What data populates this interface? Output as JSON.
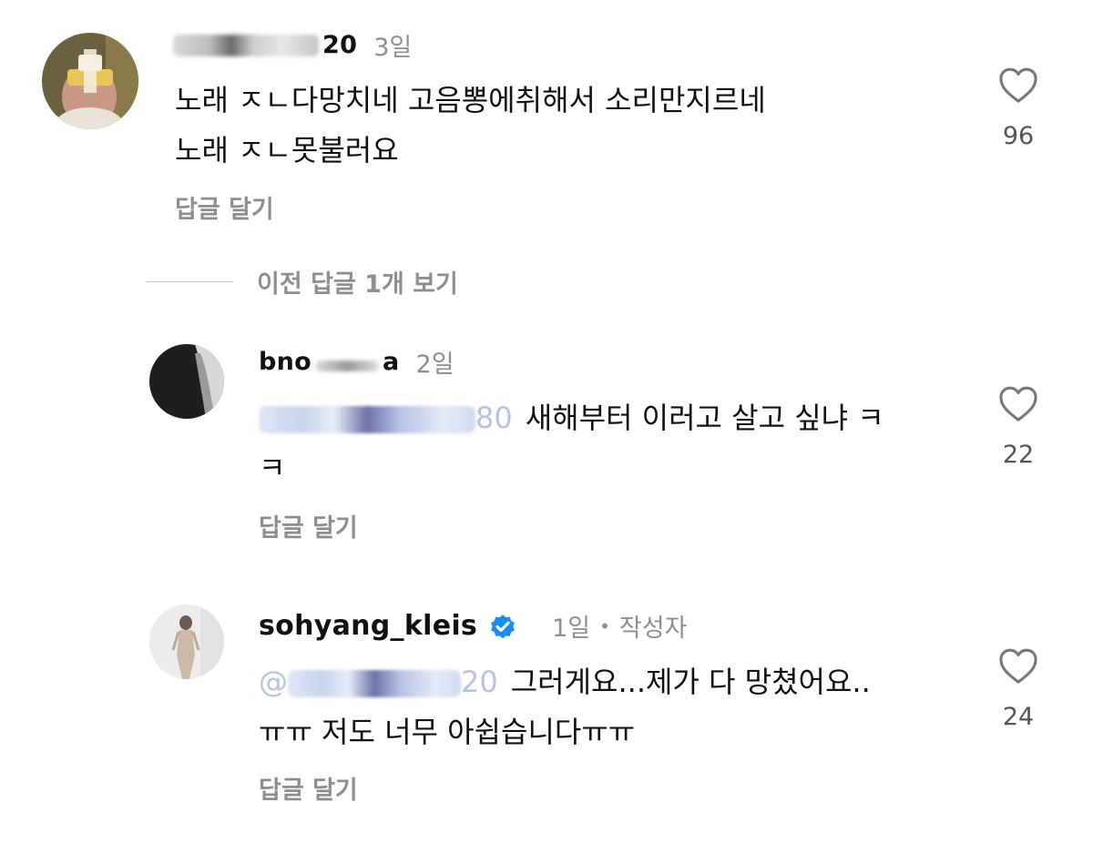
{
  "comments": [
    {
      "username_suffix": "20",
      "time": "3일",
      "text_line1": "노래 ㅈㄴ다망치네 고음뽕에취해서 소리만지르네",
      "text_line2": "노래 ㅈㄴ못불러요",
      "reply_label": "답글 달기",
      "likes": "96",
      "like_icon": "heart-outline-icon"
    },
    {
      "username_prefix": "bno",
      "username_suffix": "a",
      "time": "2일",
      "mention_suffix": "80",
      "text_line1": "새해부터 이러고 살고 싶냐 ㅋ",
      "text_line2": "ㅋ",
      "reply_label": "답글 달기",
      "likes": "22",
      "like_icon": "heart-outline-icon"
    },
    {
      "username": "sohyang_kleis",
      "verified": true,
      "verified_icon": "verified-badge-icon",
      "time": "1일",
      "separator": "•",
      "author_tag": "작성자",
      "mention_prefix": "@",
      "mention_suffix": "20",
      "text_line1": "그러게요...제가 다 망쳤어요..",
      "text_line2": "ㅠㅠ 저도 너무 아쉽습니다ㅠㅠ",
      "reply_label": "답글 달기",
      "likes": "24",
      "like_icon": "heart-outline-icon"
    }
  ],
  "view_previous_replies": "이전 답글 1개 보기",
  "colors": {
    "text": "#111111",
    "muted": "#8e8e8e",
    "verified": "#1a8cf0",
    "mention": "#3a5ca8"
  }
}
